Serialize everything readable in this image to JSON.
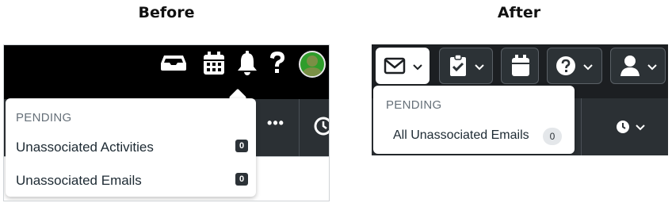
{
  "before": {
    "heading": "Before",
    "toolbar_icons": [
      "inbox-icon",
      "calendar-icon",
      "bell-icon",
      "help-icon",
      "avatar"
    ],
    "more_label": "•••",
    "dropdown": {
      "section": "PENDING",
      "items": [
        {
          "label": "Unassociated Activities",
          "count": "0"
        },
        {
          "label": "Unassociated Emails",
          "count": "0"
        }
      ]
    }
  },
  "after": {
    "heading": "After",
    "toolbar_icons": [
      "envelope-icon",
      "clipboard-check-icon",
      "calendar-icon",
      "help-icon",
      "user-icon"
    ],
    "dropdown": {
      "section": "PENDING",
      "items": [
        {
          "label": "All Unassociated Emails",
          "count": "0"
        }
      ]
    }
  },
  "colors": {
    "toolbar_dark": "#000000",
    "subbar": "#2b3034",
    "after_toolbar": "#1c1f22",
    "avatar_green": "#2f9d2b"
  }
}
